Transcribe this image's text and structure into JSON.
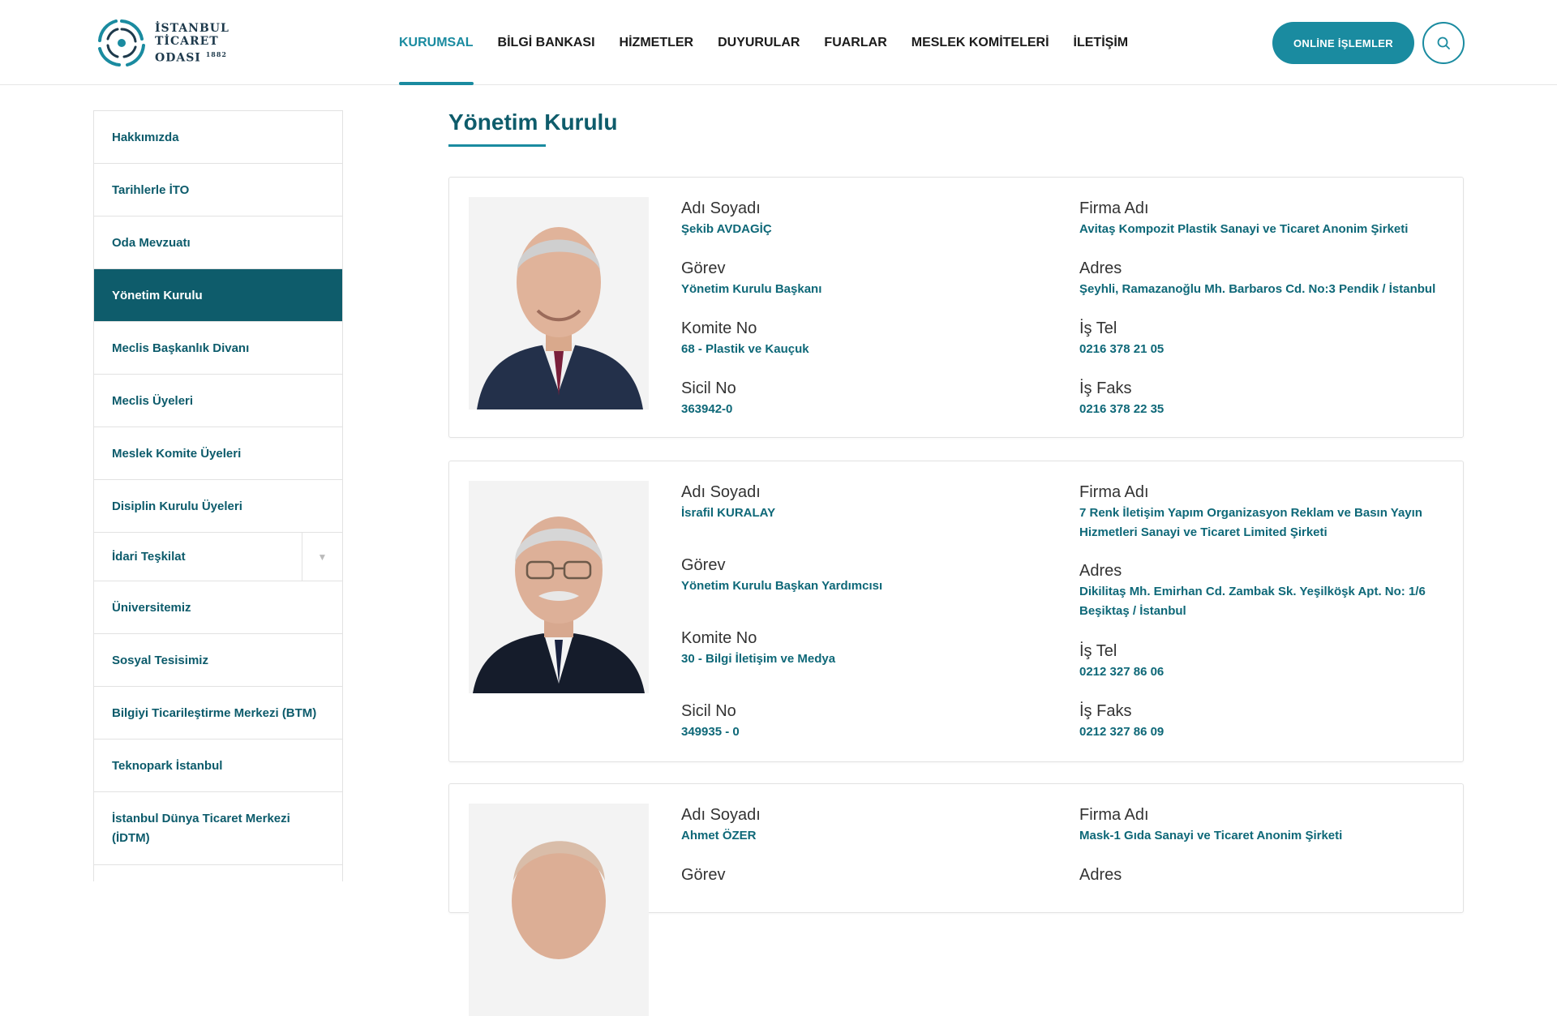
{
  "header": {
    "logo": {
      "line1": "İSTANBUL",
      "line2": "TİCARET",
      "line3": "ODASI",
      "since": "1882"
    },
    "nav": [
      "KURUMSAL",
      "BİLGİ BANKASI",
      "HİZMETLER",
      "DUYURULAR",
      "FUARLAR",
      "MESLEK KOMİTELERİ",
      "İLETİŞİM"
    ],
    "online_label": "ONLİNE İŞLEMLER",
    "colors": {
      "accent": "#1a8ba0",
      "dark": "#0e5c6b"
    }
  },
  "sidebar": {
    "items": [
      "Hakkımızda",
      "Tarihlerle İTO",
      "Oda Mevzuatı",
      "Yönetim Kurulu",
      "Meclis Başkanlık Divanı",
      "Meclis Üyeleri",
      "Meslek Komite Üyeleri",
      "Disiplin Kurulu Üyeleri",
      "İdari Teşkilat",
      "Üniversitemiz",
      "Sosyal Tesisimiz",
      "Bilgiyi Ticarileştirme Merkezi (BTM)",
      "Teknopark İstanbul",
      "İstanbul Dünya Ticaret Merkezi (İDTM)"
    ],
    "active": "Yönetim Kurulu"
  },
  "main": {
    "title": "Yönetim Kurulu",
    "labels": {
      "name": "Adı Soyadı",
      "role": "Görev",
      "committee": "Komite No",
      "registry": "Sicil No",
      "company": "Firma Adı",
      "address": "Adres",
      "phone": "İş Tel",
      "fax": "İş Faks"
    },
    "members": [
      {
        "name": "Şekib AVDAGİÇ",
        "role": "Yönetim Kurulu Başkanı",
        "committee": "68 - Plastik ve Kauçuk",
        "registry": "363942-0",
        "company": "Avitaş Kompozit Plastik Sanayi ve Ticaret Anonim Şirketi",
        "address": "Şeyhli, Ramazanoğlu Mh. Barbaros Cd. No:3 Pendik / İstanbul",
        "phone": "0216 378 21 05",
        "fax": "0216 378 22 35"
      },
      {
        "name": "İsrafil KURALAY",
        "role": "Yönetim Kurulu Başkan Yardımcısı",
        "committee": "30 - Bilgi İletişim ve Medya",
        "registry": "349935 - 0",
        "company": "7 Renk İletişim Yapım Organizasyon Reklam ve Basın Yayın Hizmetleri Sanayi ve Ticaret Limited Şirketi",
        "address": "Dikilitaş Mh. Emirhan Cd. Zambak Sk. Yeşilköşk Apt. No: 1/6 Beşiktaş / İstanbul",
        "phone": "0212 327 86 06",
        "fax": "0212 327 86 09"
      },
      {
        "name": "Ahmet ÖZER",
        "company": "Mask-1 Gıda Sanayi ve Ticaret Anonim Şirketi"
      }
    ]
  }
}
